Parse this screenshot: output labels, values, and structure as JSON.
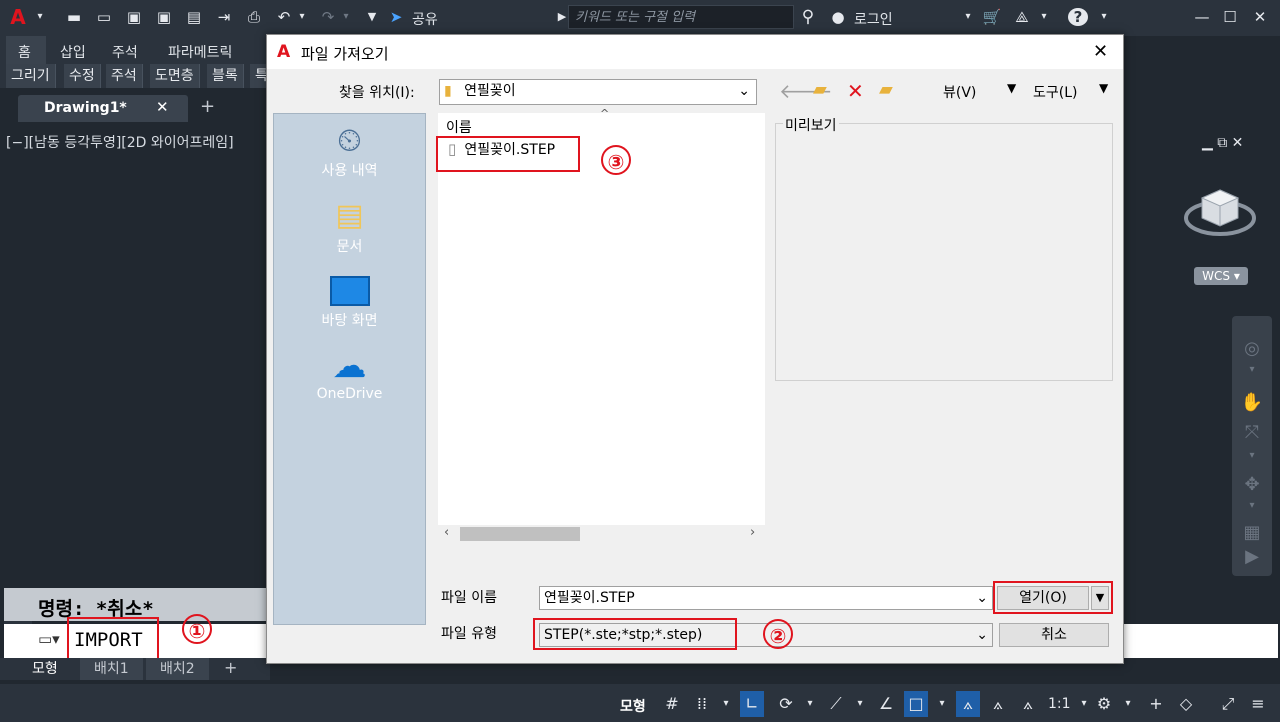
{
  "app": {
    "share_label": "공유",
    "search_placeholder": "키워드 또는 구절 입력",
    "login_label": "로그인"
  },
  "ribbon": {
    "tabs": [
      "홈",
      "삽입",
      "주석",
      "파라메트릭"
    ],
    "panels": [
      "그리기",
      "수정",
      "주석",
      "도면층",
      "블록",
      "특"
    ]
  },
  "document": {
    "tab_label": "Drawing1*",
    "viewport_label": "[−][남동 등각투영][2D 와이어프레임]",
    "wcs_label": "WCS"
  },
  "command": {
    "history_text": "명령: *취소*",
    "input_text": "IMPORT"
  },
  "layout_tabs": [
    "모형",
    "배치1",
    "배치2"
  ],
  "statusbar": {
    "model_label": "모형",
    "scale_label": "1:1"
  },
  "dialog": {
    "title": "파일 가져오기",
    "lookin_label": "찾을 위치(I):",
    "lookin_value": "연필꽂이",
    "view_label": "뷰(V)",
    "tools_label": "도구(L)",
    "places": [
      "사용 내역",
      "문서",
      "바탕 화면",
      "OneDrive"
    ],
    "column_name": "이름",
    "files": [
      "연필꽂이.STEP"
    ],
    "preview_label": "미리보기",
    "filename_label": "파일 이름",
    "filename_value": "연필꽂이.STEP",
    "filetype_label": "파일 유형",
    "filetype_value": "STEP(*.ste;*stp;*.step)",
    "open_button": "열기(O)",
    "cancel_button": "취소"
  },
  "annotations": [
    "①",
    "②",
    "③"
  ],
  "colors": {
    "accent_red": "#e0141e",
    "ui_dark": "#212830",
    "statusbar_blue": "#1f5fa8"
  }
}
